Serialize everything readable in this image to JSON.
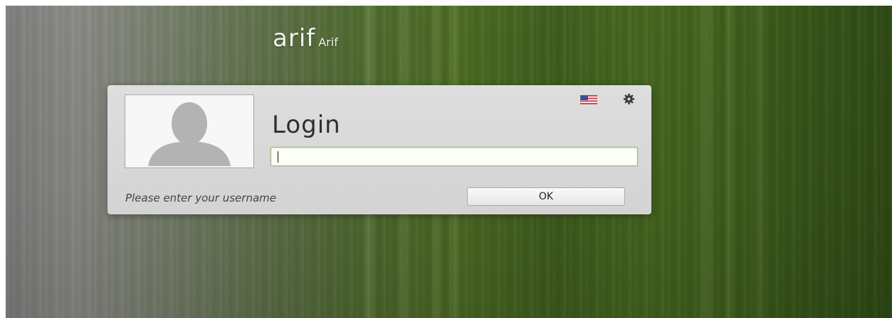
{
  "header": {
    "hostname": "arif",
    "fullname": "Arif"
  },
  "login": {
    "title": "Login",
    "username_value": "",
    "status_message": "Please enter your username",
    "ok_label": "OK"
  },
  "toolbar": {
    "language_icon": "us-flag-icon",
    "settings_icon": "gear-icon"
  },
  "colors": {
    "background_accent": "#4b6a22",
    "panel_bg": "#d8d8d8",
    "input_bg": "#fcfff5"
  }
}
